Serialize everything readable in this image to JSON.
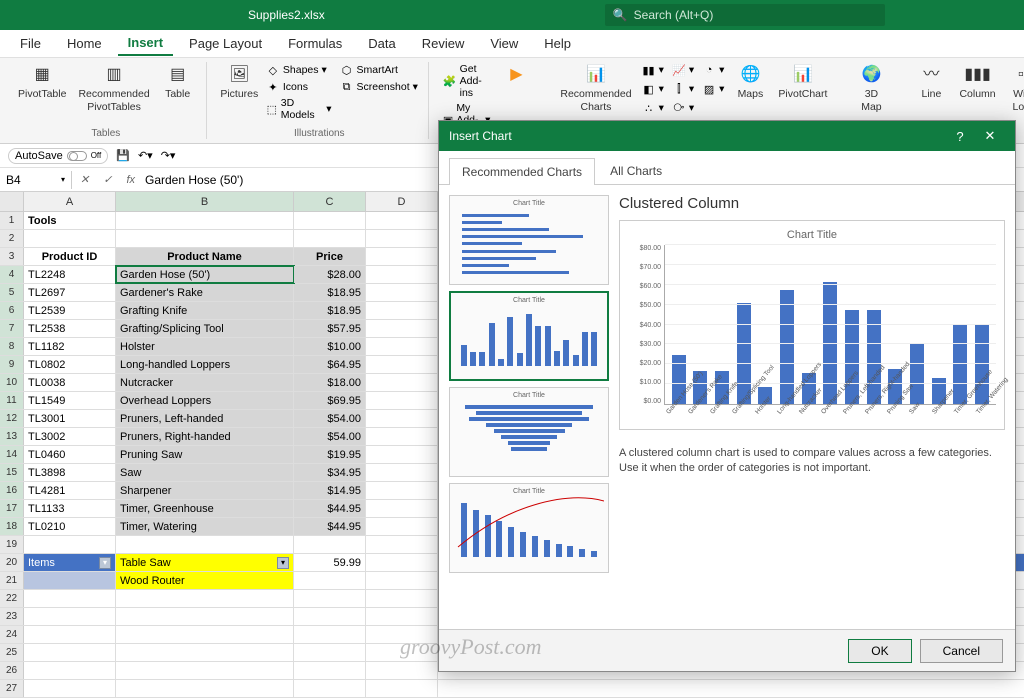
{
  "app": {
    "filename": "Supplies2.xlsx",
    "search_placeholder": "Search (Alt+Q)"
  },
  "tabs": [
    "File",
    "Home",
    "Insert",
    "Page Layout",
    "Formulas",
    "Data",
    "Review",
    "View",
    "Help"
  ],
  "active_tab": "Insert",
  "ribbon": {
    "pivottable": "PivotTable",
    "recpivot": "Recommended\nPivotTables",
    "table": "Table",
    "tables_group": "Tables",
    "pictures": "Pictures",
    "shapes": "Shapes",
    "icons": "Icons",
    "models": "3D Models",
    "smartart": "SmartArt",
    "screenshot": "Screenshot",
    "illustrations_group": "Illustrations",
    "getaddins": "Get Add-ins",
    "myaddins": "My Add-ins",
    "recchart": "Recommended\nCharts",
    "maps": "Maps",
    "pivotchart": "PivotChart",
    "globe": "3D\nMap",
    "line": "Line",
    "column": "Column",
    "winloss": "Win/\nLoss"
  },
  "quickbar": {
    "autosave": "AutoSave",
    "off": "Off"
  },
  "formula": {
    "cellref": "B4",
    "value": "Garden Hose (50')"
  },
  "columns": [
    "A",
    "B",
    "C",
    "D"
  ],
  "sheet": {
    "title": "Tools",
    "headers": {
      "id": "Product ID",
      "name": "Product Name",
      "price": "Price"
    },
    "rows": [
      {
        "id": "TL2248",
        "name": "Garden Hose (50')",
        "price": "$28.00"
      },
      {
        "id": "TL2697",
        "name": "Gardener's Rake",
        "price": "$18.95"
      },
      {
        "id": "TL2539",
        "name": "Grafting Knife",
        "price": "$18.95"
      },
      {
        "id": "TL2538",
        "name": "Grafting/Splicing Tool",
        "price": "$57.95"
      },
      {
        "id": "TL1182",
        "name": "Holster",
        "price": "$10.00"
      },
      {
        "id": "TL0802",
        "name": "Long-handled Loppers",
        "price": "$64.95"
      },
      {
        "id": "TL0038",
        "name": "Nutcracker",
        "price": "$18.00"
      },
      {
        "id": "TL1549",
        "name": "Overhead Loppers",
        "price": "$69.95"
      },
      {
        "id": "TL3001",
        "name": "Pruners, Left-handed",
        "price": "$54.00"
      },
      {
        "id": "TL3002",
        "name": "Pruners, Right-handed",
        "price": "$54.00"
      },
      {
        "id": "TL0460",
        "name": "Pruning Saw",
        "price": "$19.95"
      },
      {
        "id": "TL3898",
        "name": "Saw",
        "price": "$34.95"
      },
      {
        "id": "TL4281",
        "name": "Sharpener",
        "price": "$14.95"
      },
      {
        "id": "TL1133",
        "name": "Timer, Greenhouse",
        "price": "$44.95"
      },
      {
        "id": "TL0210",
        "name": "Timer, Watering",
        "price": "$44.95"
      }
    ],
    "items_label": "Items",
    "items_sel": "Table Saw",
    "items_price": "59.99",
    "items_row2": "Wood Router"
  },
  "dialog": {
    "title": "Insert Chart",
    "tab_rec": "Recommended Charts",
    "tab_all": "All Charts",
    "selected_name": "Clustered Column",
    "chart_title": "Chart Title",
    "thumb_title": "Chart Title",
    "desc": "A clustered column chart is used to compare values across a few categories. Use it when the order of categories is not important.",
    "ok": "OK",
    "cancel": "Cancel"
  },
  "chart_data": {
    "type": "bar",
    "title": "Chart Title",
    "xlabel": "",
    "ylabel": "",
    "ylim": [
      0,
      80
    ],
    "yticks": [
      "$80.00",
      "$70.00",
      "$60.00",
      "$50.00",
      "$40.00",
      "$30.00",
      "$20.00",
      "$10.00",
      "$0.00"
    ],
    "categories": [
      "Garden Hose (50')",
      "Gardener's Rake",
      "Grafting Knife",
      "Grafting/Splicing Tool",
      "Holster",
      "Long-handled Loppers",
      "Nutcracker",
      "Overhead Loppers",
      "Pruners, Left-handed",
      "Pruners, Right-handed",
      "Pruning Saw",
      "Saw",
      "Sharpener",
      "Timer, Greenhouse",
      "Timer, Watering"
    ],
    "values": [
      28.0,
      18.95,
      18.95,
      57.95,
      10.0,
      64.95,
      18.0,
      69.95,
      54.0,
      54.0,
      19.95,
      34.95,
      14.95,
      44.95,
      44.95
    ]
  },
  "watermark": "groovyPost.com"
}
